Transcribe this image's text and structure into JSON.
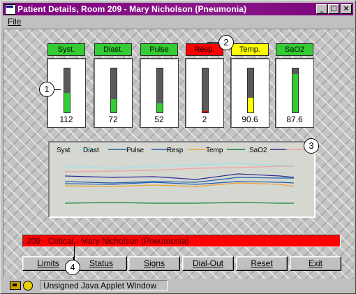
{
  "window": {
    "title": "Patient Details,  Room 209 - Mary Nicholson  (Pneumonia)",
    "controls": {
      "minimize": "_",
      "maximize": "□",
      "close": "×"
    }
  },
  "menu": {
    "file": "File"
  },
  "vitals": [
    {
      "label": "Syst.",
      "value": "112",
      "label_color": "#33cc33",
      "fill_color": "#33cc33",
      "fill_fraction": 0.44
    },
    {
      "label": "Diast.",
      "value": "72",
      "label_color": "#33cc33",
      "fill_color": "#33cc33",
      "fill_fraction": 0.3
    },
    {
      "label": "Pulse",
      "value": "52",
      "label_color": "#33cc33",
      "fill_color": "#33cc33",
      "fill_fraction": 0.21
    },
    {
      "label": "Resp.",
      "value": "2",
      "label_color": "#ff0000",
      "fill_color": "#cc0000",
      "fill_fraction": 0.03
    },
    {
      "label": "Temp.",
      "value": "90.6",
      "label_color": "#ffff00",
      "fill_color": "#ffff00",
      "fill_fraction": 0.33
    },
    {
      "label": "SaO2",
      "value": "87.6",
      "label_color": "#33cc33",
      "fill_color": "#33cc33",
      "fill_fraction": 0.88
    }
  ],
  "trend": {
    "legend": [
      {
        "name": "Syst",
        "color": "#9ee0f0"
      },
      {
        "name": "Diast",
        "color": "#1f5fa8"
      },
      {
        "name": "Pulse",
        "color": "#2060b0"
      },
      {
        "name": "Resp",
        "color": "#f0a030"
      },
      {
        "name": "Temp",
        "color": "#108030"
      },
      {
        "name": "SaO2",
        "color": "#2a2a90"
      },
      {
        "name": "",
        "color": "#f0a0a0"
      }
    ]
  },
  "alert": {
    "text": "209 - Critical - Mary Nicholson  (Pneumonia)"
  },
  "buttons": {
    "limits": "Limits",
    "status": "Status",
    "signs": "Signs",
    "dialout": "Dial-Out",
    "reset": "Reset",
    "exit": "Exit"
  },
  "callouts": {
    "one": "1",
    "two": "2",
    "three": "3",
    "four": "4"
  },
  "statusbar": {
    "text": "Unsigned Java Applet Window"
  }
}
